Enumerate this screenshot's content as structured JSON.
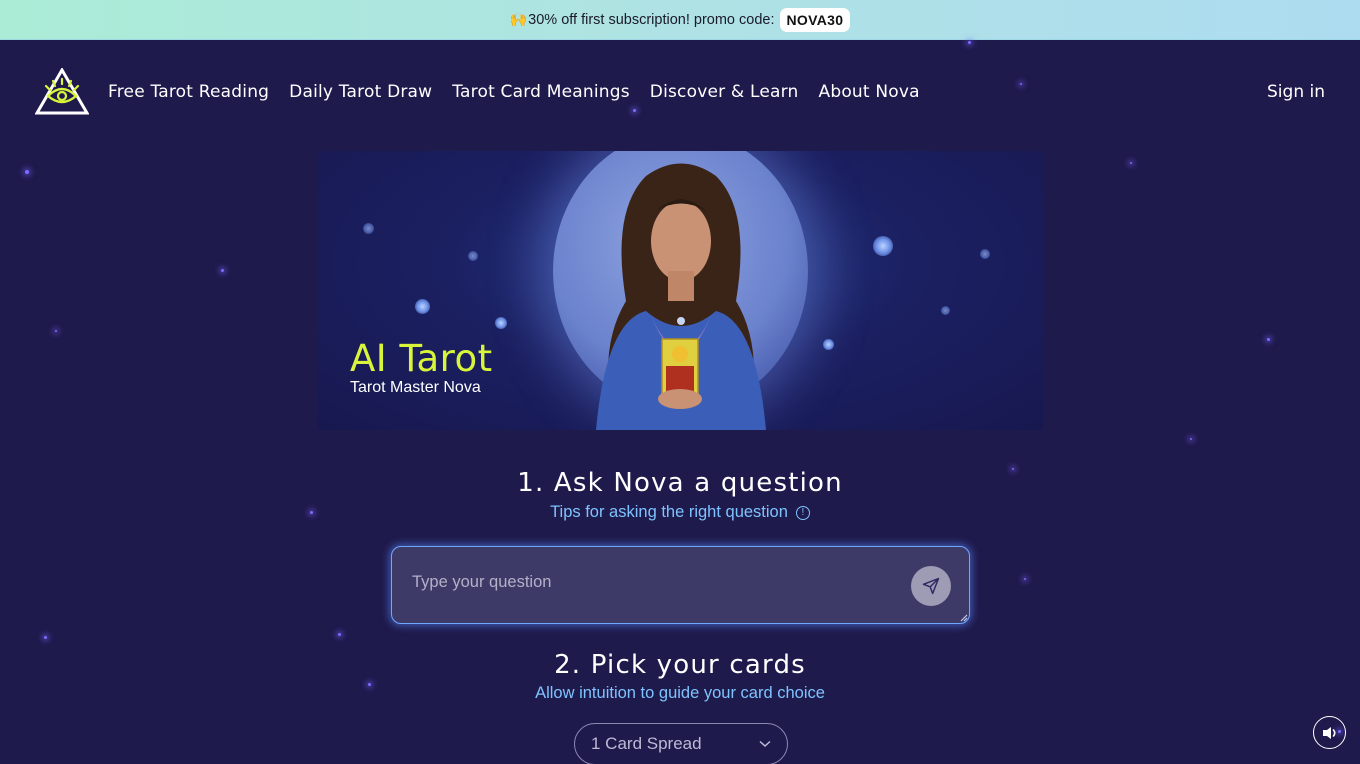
{
  "promo": {
    "emoji": "🙌",
    "text": "30% off first subscription! promo code:",
    "code": "NOVA30"
  },
  "nav": {
    "logo": "eye-triangle-logo",
    "links": [
      {
        "label": "Free Tarot Reading"
      },
      {
        "label": "Daily Tarot Draw"
      },
      {
        "label": "Tarot Card Meanings"
      },
      {
        "label": "Discover & Learn"
      },
      {
        "label": "About Nova"
      }
    ],
    "sign_in": "Sign in"
  },
  "hero": {
    "title": "AI Tarot",
    "subtitle": "Tarot Master Nova",
    "image": "tarot-reader-with-moon"
  },
  "step1": {
    "title": "1. Ask Nova a question",
    "tips": "Tips for asking the right question",
    "tips_icon": "info-icon",
    "input_placeholder": "Type your question",
    "input_value": "",
    "send_icon": "send-icon"
  },
  "step2": {
    "title": "2. Pick your cards",
    "subtitle": "Allow intuition to guide your card choice",
    "spread_selected": "1 Card Spread",
    "spread_icon": "chevron-down-icon"
  },
  "sound": {
    "icon": "speaker-icon"
  },
  "colors": {
    "background": "#1f1a4c",
    "accent_yellow": "#d9f53a",
    "link_blue": "#7ec3ff",
    "input_border": "#6fa7ff"
  }
}
